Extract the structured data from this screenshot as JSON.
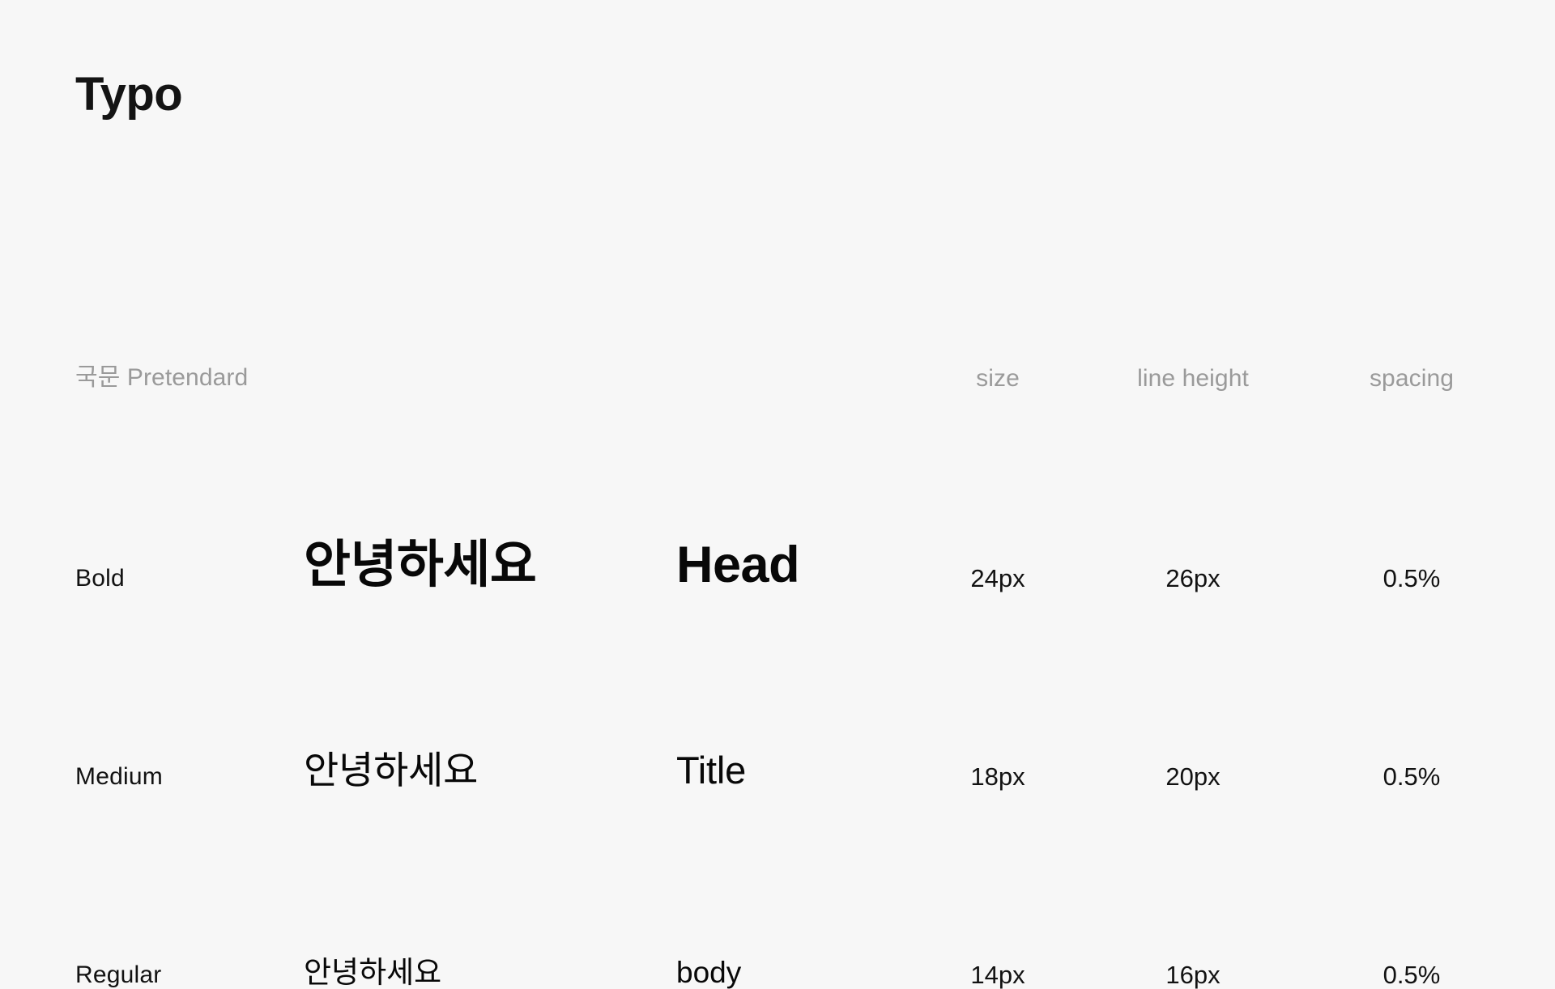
{
  "page": {
    "title": "Typo",
    "background_color": "#f7f7f7",
    "text_color": "#111111",
    "muted_color": "#9a9a9a"
  },
  "table": {
    "headers": {
      "family": "국문 Pretendard",
      "size": "size",
      "line_height": "line height",
      "spacing": "spacing"
    },
    "rows": [
      {
        "weight": "Bold",
        "sample_ko": "안녕하세요",
        "sample_latin": "Head",
        "size": "24px",
        "line_height": "26px",
        "spacing": "0.5%"
      },
      {
        "weight": "Medium",
        "sample_ko": "안녕하세요",
        "sample_latin": "Title",
        "size": "18px",
        "line_height": "20px",
        "spacing": "0.5%"
      },
      {
        "weight": "Regular",
        "sample_ko": "안녕하세요",
        "sample_latin": "body",
        "size": "14px",
        "line_height": "16px",
        "spacing": "0.5%"
      }
    ]
  }
}
